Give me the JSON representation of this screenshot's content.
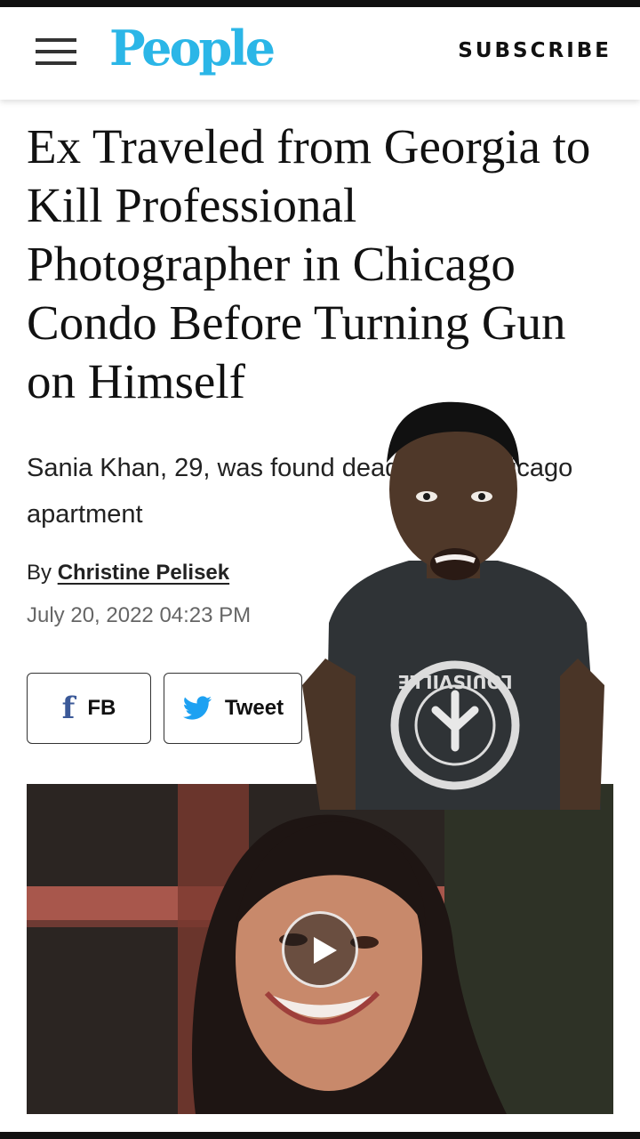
{
  "header": {
    "logo": "People",
    "subscribe_label": "SUBSCRIBE"
  },
  "article": {
    "headline": "Ex Traveled from Georgia to Kill Professional Photographer in Chicago Condo Before Turning Gun on Himself",
    "dek": "Sania Khan, 29, was found dead in her Chicago apartment",
    "by_prefix": "By",
    "author": "Christine Pelisek",
    "date": "July 20, 2022 04:23 PM"
  },
  "share": {
    "fb_label": "FB",
    "tweet_label": "Tweet"
  },
  "overlay": {
    "shirt_text": "LOUISVILLE"
  },
  "colors": {
    "logo": "#2bb6e7",
    "facebook": "#3b5998",
    "twitter": "#1da1f2"
  }
}
